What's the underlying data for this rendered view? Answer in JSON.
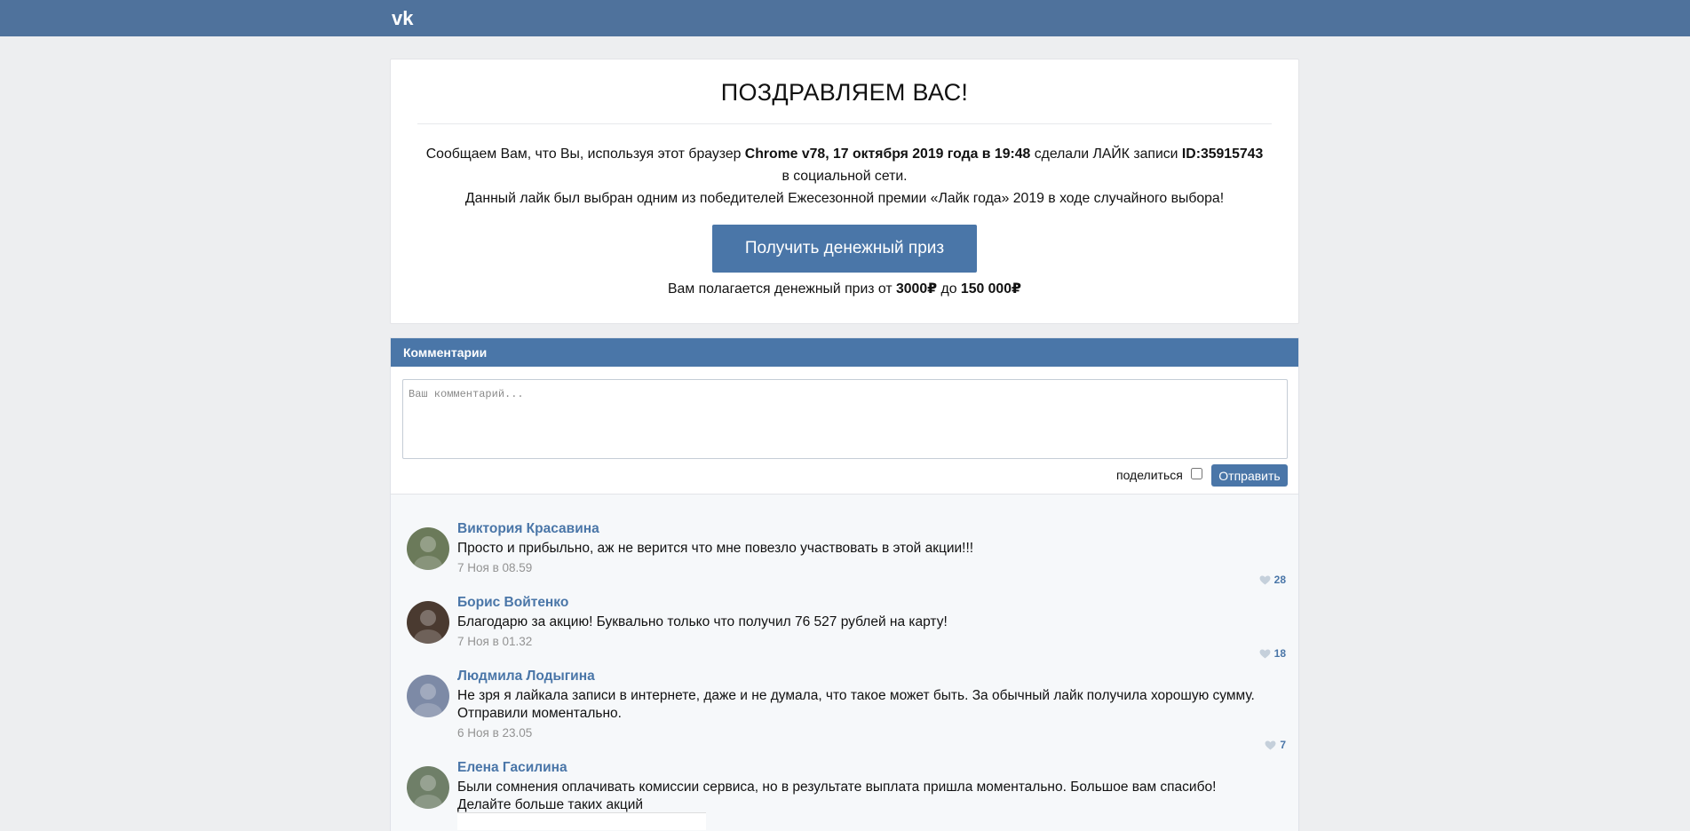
{
  "brand": {
    "logo_text": "vk"
  },
  "card": {
    "title": "ПОЗДРАВЛЯЕМ ВАС!",
    "msg_prefix": "Сообщаем Вам, что Вы, используя этот браузер ",
    "msg_bold1": "Chrome v78, 17 октября 2019 года в 19:48",
    "msg_mid": " сделали ЛАЙК записи ",
    "msg_bold2": "ID:35915743",
    "msg_line2": "в социальной сети.",
    "msg_line3": "Данный лайк был выбран одним из победителей Ежесезонной премии «Лайк года» 2019 в ходе случайного выбора!",
    "button": "Получить денежный приз",
    "prize_prefix": "Вам полагается денежный приз от ",
    "prize_min": "3000₽",
    "prize_mid": " до ",
    "prize_max": "150 000₽"
  },
  "comments": {
    "header": "Комментарии",
    "placeholder": "Ваш комментарий...",
    "share_label": "поделиться",
    "share_checked": false,
    "send": "Отправить",
    "items": [
      {
        "name": "Виктория Красавина",
        "text": "Просто и прибыльно, аж не верится что мне повезло участвовать в этой акции!!!",
        "text2": "",
        "date": "7 Ноя в 08.59",
        "likes": "28",
        "avatar_color": "#6b7a5a"
      },
      {
        "name": "Борис Войтенко",
        "text": "Благодарю за акцию! Буквально только что получил 76 527 рублей на карту!",
        "text2": "",
        "date": "7 Ноя в 01.32",
        "likes": "18",
        "avatar_color": "#4a3a30"
      },
      {
        "name": "Людмила Лодыгина",
        "text": "Не зря я лайкала записи в интернете, даже и не думала, что такое может быть. За обычный лайк получила хорошую сумму.",
        "text2": "Отправили моментально.",
        "date": "6 Ноя в 23.05",
        "likes": "7",
        "avatar_color": "#7d8aa6"
      },
      {
        "name": "Елена Гасилина",
        "text": "Были сомнения оплачивать комиссии сервиса, но в результате выплата пришла моментально. Большое вам спасибо!",
        "text2": "Делайте больше таких акций",
        "date": "",
        "likes": "",
        "avatar_color": "#6f7f68"
      }
    ]
  },
  "colors": {
    "brand_blue": "#4a76a8",
    "topbar": "#4f729c",
    "bg": "#edeef0"
  }
}
